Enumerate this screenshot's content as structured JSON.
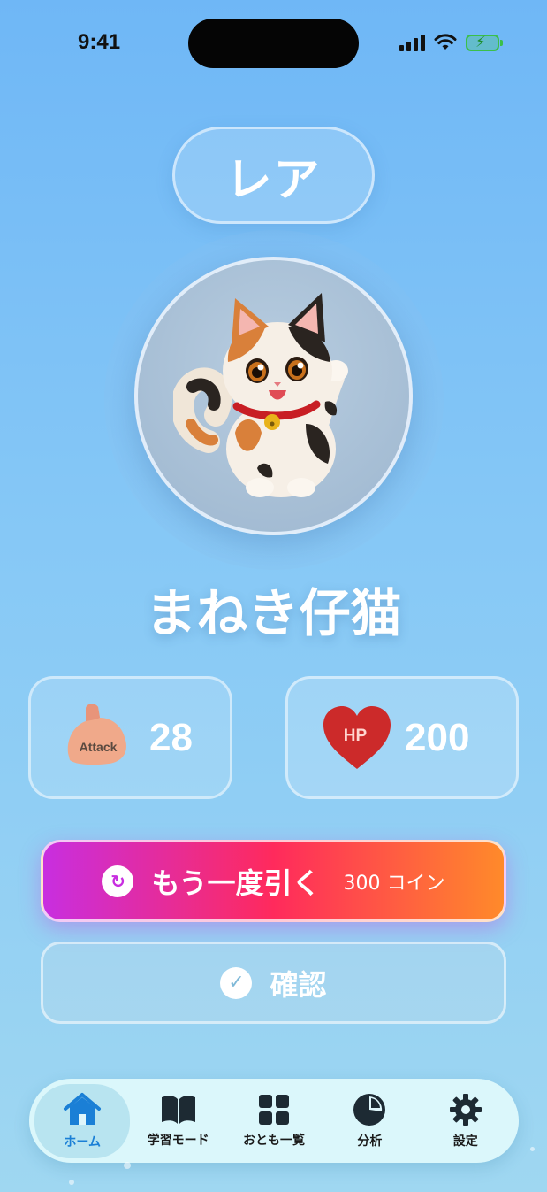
{
  "status_bar": {
    "time": "9:41"
  },
  "rarity": "レア",
  "character": {
    "name": "まねき仔猫"
  },
  "stats": {
    "attack": {
      "icon_text": "Attack",
      "value": "28"
    },
    "hp": {
      "icon_text": "HP",
      "value": "200"
    }
  },
  "actions": {
    "redraw": {
      "label": "もう一度引く",
      "cost": "300 コイン"
    },
    "confirm": {
      "label": "確認"
    }
  },
  "tabs": [
    {
      "label": "ホーム",
      "icon": "home-icon",
      "active": true
    },
    {
      "label": "学習モード",
      "icon": "book-icon",
      "active": false
    },
    {
      "label": "おとも一覧",
      "icon": "grid-icon",
      "active": false
    },
    {
      "label": "分析",
      "icon": "pie-chart-icon",
      "active": false
    },
    {
      "label": "設定",
      "icon": "gear-icon",
      "active": false
    }
  ],
  "colors": {
    "background_top": "#6fb7f6",
    "background_bottom": "#9fd7f1",
    "accent_gradient": [
      "#c82ee0",
      "#ff2a5c",
      "#ff8a2a"
    ],
    "active_tab": "#1a7fd6",
    "heart": "#cc2a2a"
  }
}
